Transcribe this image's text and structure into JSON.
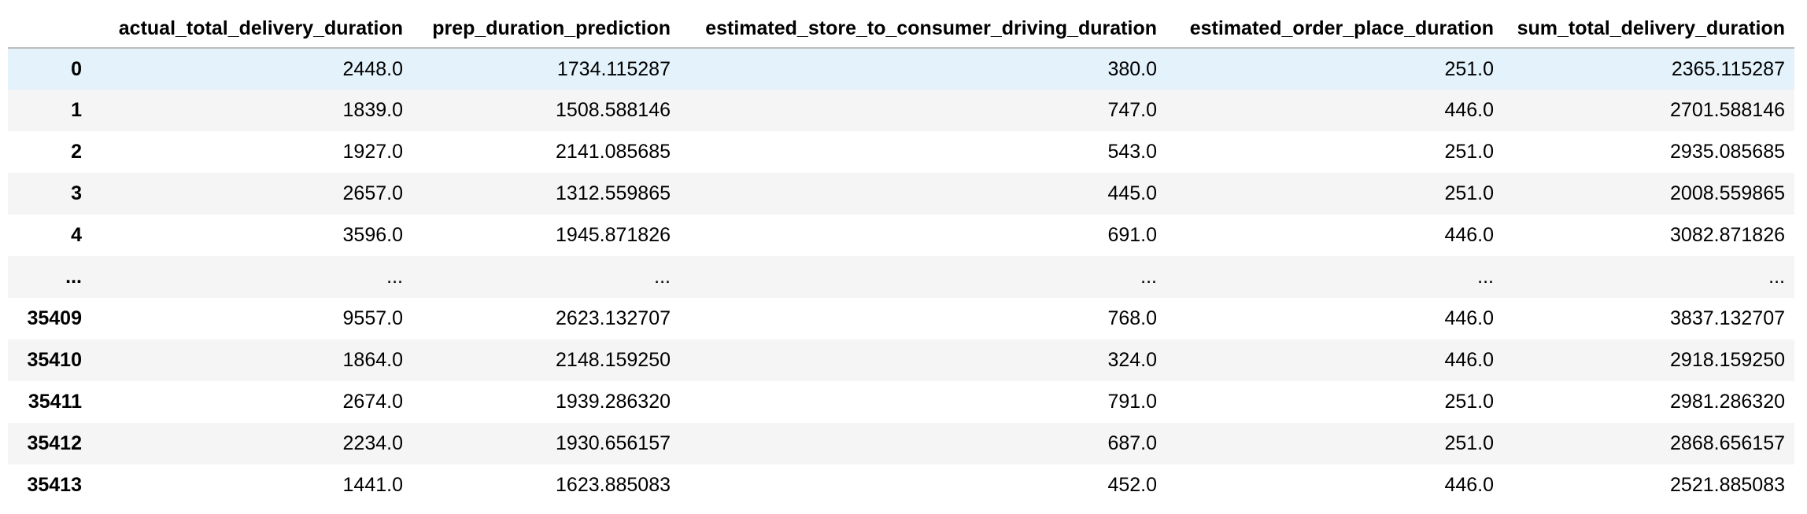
{
  "table": {
    "columns": [
      "",
      "actual_total_delivery_duration",
      "prep_duration_prediction",
      "estimated_store_to_consumer_driving_duration",
      "estimated_order_place_duration",
      "sum_total_delivery_duration"
    ],
    "rows": [
      {
        "index": "0",
        "cells": [
          "2448.0",
          "1734.115287",
          "380.0",
          "251.0",
          "2365.115287"
        ],
        "highlighted": true
      },
      {
        "index": "1",
        "cells": [
          "1839.0",
          "1508.588146",
          "747.0",
          "446.0",
          "2701.588146"
        ]
      },
      {
        "index": "2",
        "cells": [
          "1927.0",
          "2141.085685",
          "543.0",
          "251.0",
          "2935.085685"
        ]
      },
      {
        "index": "3",
        "cells": [
          "2657.0",
          "1312.559865",
          "445.0",
          "251.0",
          "2008.559865"
        ]
      },
      {
        "index": "4",
        "cells": [
          "3596.0",
          "1945.871826",
          "691.0",
          "446.0",
          "3082.871826"
        ]
      },
      {
        "index": "...",
        "cells": [
          "...",
          "...",
          "...",
          "...",
          "..."
        ]
      },
      {
        "index": "35409",
        "cells": [
          "9557.0",
          "2623.132707",
          "768.0",
          "446.0",
          "3837.132707"
        ]
      },
      {
        "index": "35410",
        "cells": [
          "1864.0",
          "2148.159250",
          "324.0",
          "446.0",
          "2918.159250"
        ]
      },
      {
        "index": "35411",
        "cells": [
          "2674.0",
          "1939.286320",
          "791.0",
          "251.0",
          "2981.286320"
        ]
      },
      {
        "index": "35412",
        "cells": [
          "2234.0",
          "1930.656157",
          "687.0",
          "251.0",
          "2868.656157"
        ]
      },
      {
        "index": "35413",
        "cells": [
          "1441.0",
          "1623.885083",
          "452.0",
          "446.0",
          "2521.885083"
        ]
      }
    ]
  },
  "colors": {
    "row_stripe": "#f5f5f5",
    "row_hover": "#e3f2fb",
    "header_border": "#bdbdbd"
  }
}
